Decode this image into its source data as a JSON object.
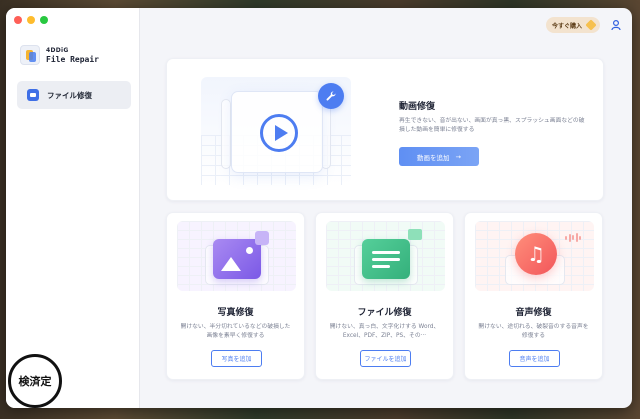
{
  "app": {
    "brand": "4DDiG",
    "product": "File Repair"
  },
  "sidebar": {
    "items": [
      {
        "label": "ファイル修復",
        "icon": "folder-icon",
        "active": true
      }
    ]
  },
  "header": {
    "buy_label": "今すぐ購入",
    "buy_icon": "diamond-icon",
    "user_icon": "user-icon"
  },
  "video_repair": {
    "title": "動画修復",
    "description": "再生できない、音が出ない、画面が真っ黒、スプラッシュ画面などの破損した動画を簡単に修復する",
    "button_label": "動画を追加",
    "button_arrow": "→",
    "icon": "play-icon"
  },
  "photo_repair": {
    "title": "写真修復",
    "description": "開けない、半分切れているなどの破損した画像を素早く修復する",
    "button_label": "写真を追加",
    "icon": "image-icon"
  },
  "file_repair": {
    "title": "ファイル修復",
    "description": "開けない、真っ白、文字化けする Word、Excel、PDF、ZIP、PS、その···",
    "button_label": "ファイルを追加",
    "icon": "document-icon"
  },
  "audio_repair": {
    "title": "音声修復",
    "description": "開けない、途切れる、破裂音のする音声を修復する",
    "button_label": "音声を追加",
    "icon": "music-note-icon",
    "glyph": "♫"
  },
  "overlay": {
    "stamp_text": "検済定"
  },
  "colors": {
    "accent": "#4d7df1",
    "photo": "#7b59e6",
    "file": "#34b07b",
    "audio": "#f2555a",
    "buy_bg": "#f3e3cf"
  }
}
